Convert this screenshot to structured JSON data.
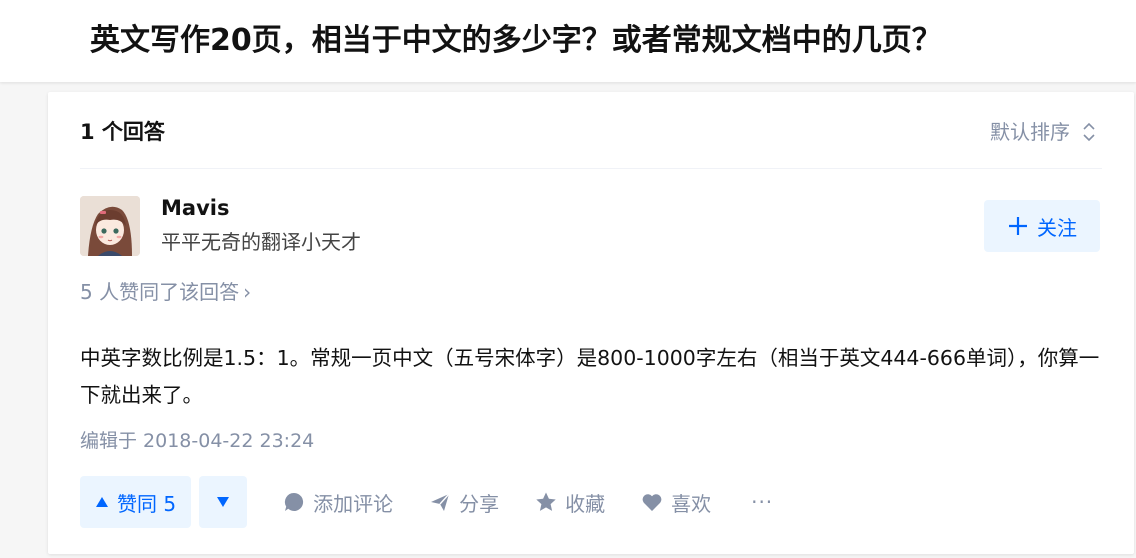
{
  "question": {
    "title": "英文写作20页，相当于中文的多少字？或者常规文档中的几页？"
  },
  "answers_header": {
    "count_label": "1 个回答",
    "sort_label": "默认排序",
    "sort_icon": "chevron-up-down-icon"
  },
  "author": {
    "name": "Mavis",
    "bio": "平平无奇的翻译小天才",
    "follow_label": "关注",
    "follow_icon": "plus-icon"
  },
  "answer": {
    "voters_label": "5 人赞同了该回答",
    "content": "中英字数比例是1.5：1。常规一页中文（五号宋体字）是800-1000字左右（相当于英文444-666单词），你算一下就出来了。",
    "edited_label": "编辑于 2018-04-22 23:24"
  },
  "actions": {
    "upvote_label": "赞同 5",
    "comment_label": "添加评论",
    "share_label": "分享",
    "collect_label": "收藏",
    "like_label": "喜欢",
    "more_label": "···"
  },
  "colors": {
    "accent": "#0066ff",
    "accent_bg": "#ebf5ff",
    "muted": "#8590a6",
    "text": "#121212"
  }
}
